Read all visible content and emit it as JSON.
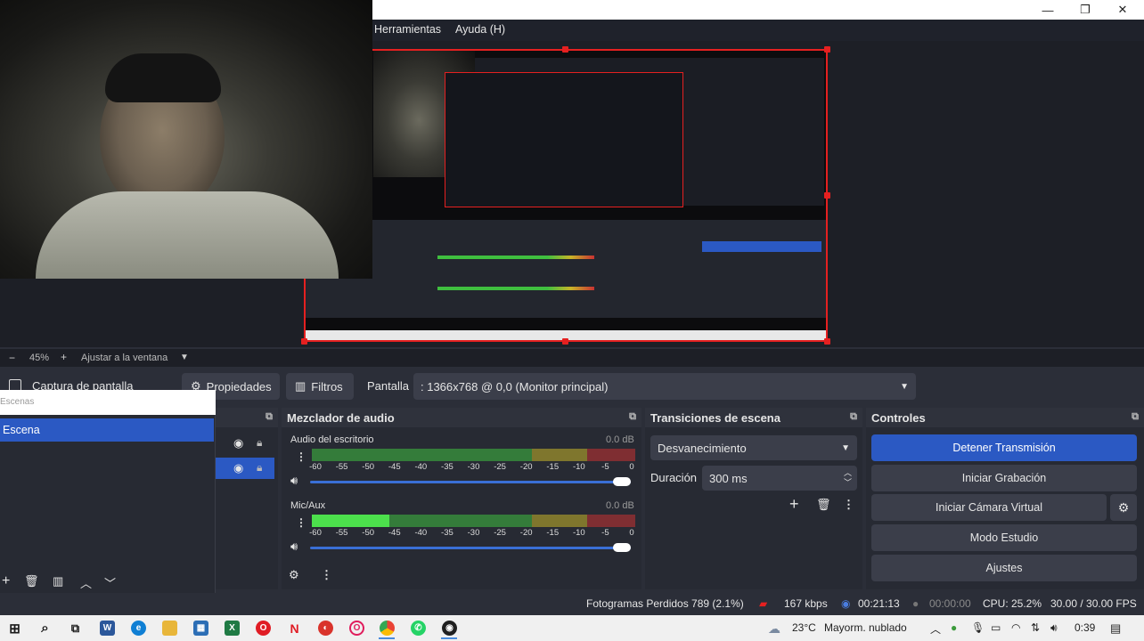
{
  "menu": {
    "tools": "Herramientas",
    "help": "Ayuda (H)"
  },
  "window_controls": {
    "minimize": "—",
    "maximize": "❐",
    "close": "✕"
  },
  "zoom": {
    "minus": "−",
    "level": "45%",
    "plus": "+",
    "fit": "Ajustar a la ventana",
    "caret": "▼"
  },
  "source_toolbar": {
    "source_name": "Captura de pantalla",
    "properties": "Propiedades",
    "filters": "Filtros",
    "display_label": "Pantalla",
    "display_value": ": 1366x768 @ 0,0 (Monitor principal)"
  },
  "scenes": {
    "title": "Escenas",
    "items": [
      "Escena"
    ]
  },
  "audio_mixer": {
    "title": "Mezclador de audio",
    "ticks": [
      "-60",
      "-55",
      "-50",
      "-45",
      "-40",
      "-35",
      "-30",
      "-25",
      "-20",
      "-15",
      "-10",
      "-5",
      "0"
    ],
    "channels": [
      {
        "name": "Audio del escritorio",
        "db": "0.0 dB",
        "level": 0.0,
        "volume": 1.0
      },
      {
        "name": "Mic/Aux",
        "db": "0.0 dB",
        "level": 0.24,
        "volume": 1.0
      }
    ]
  },
  "transitions": {
    "title": "Transiciones de escena",
    "transition": "Desvanecimiento",
    "duration_label": "Duración",
    "duration_value": "300 ms"
  },
  "controls": {
    "title": "Controles",
    "stop_stream": "Detener Transmisión",
    "start_recording": "Iniciar Grabación",
    "start_virtual_cam": "Iniciar Cámara Virtual",
    "studio_mode": "Modo Estudio",
    "settings": "Ajustes"
  },
  "status": {
    "dropped_frames": "Fotogramas Perdidos 789 (2.1%)",
    "bitrate": "167 kbps",
    "stream_time": "00:21:13",
    "rec_time": "00:00:00",
    "cpu": "CPU: 25.2%",
    "fps": "30.00 / 30.00 FPS"
  },
  "taskbar": {
    "weather": "23°C",
    "weather_desc": "Mayorm. nublado",
    "time": "0:39"
  },
  "colors": {
    "accent": "#2b59c3",
    "record_red": "#e52020",
    "meter_green": "#3fbf3f",
    "meter_yellow": "#c8b428",
    "meter_red": "#c83232"
  }
}
